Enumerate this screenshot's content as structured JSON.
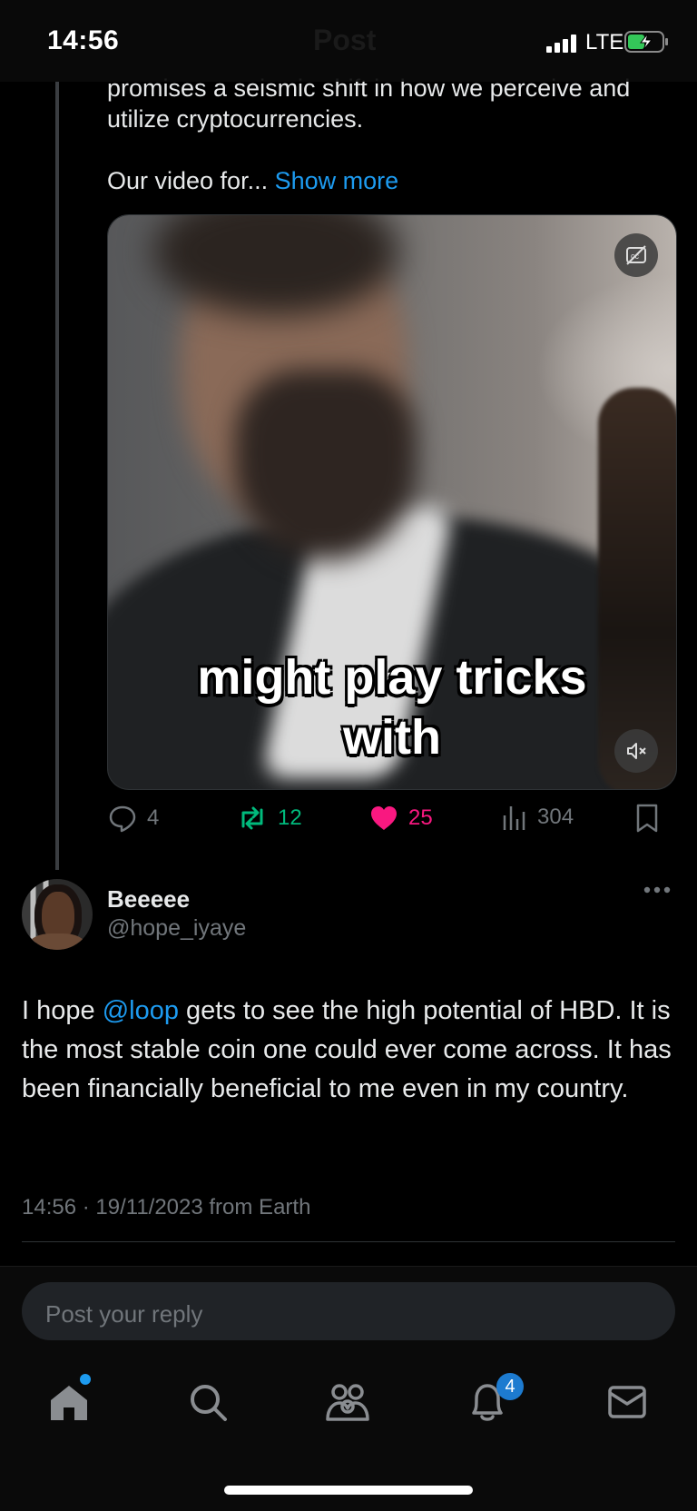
{
  "status_bar": {
    "time": "14:56",
    "network": "LTE"
  },
  "header": {
    "title": "Post"
  },
  "post": {
    "text": "promises a seismic shift in how we perceive and utilize cryptocurrencies.",
    "text_continuation": "Our video for...",
    "show_more_label": "Show more",
    "video_caption_line1": "might play tricks",
    "video_caption_line2": "with",
    "stats": {
      "replies": "4",
      "reposts": "12",
      "likes": "25",
      "views": "304"
    }
  },
  "reply": {
    "display_name": "Beeeee",
    "handle": "@hope_iyaye",
    "text_before": "I hope ",
    "mention": "@loop",
    "text_after": " gets to see the high potential of HBD. It is the most stable coin one could ever come across. It has been financially beneficial to me even in my country.",
    "timestamp": "14:56 · 19/11/2023 from Earth"
  },
  "composer": {
    "placeholder": "Post your reply"
  },
  "nav": {
    "notifications_badge": "4"
  },
  "colors": {
    "accent": "#1d9bf0",
    "repost": "#00ba7c",
    "like": "#f91880",
    "muted": "#71767b"
  }
}
